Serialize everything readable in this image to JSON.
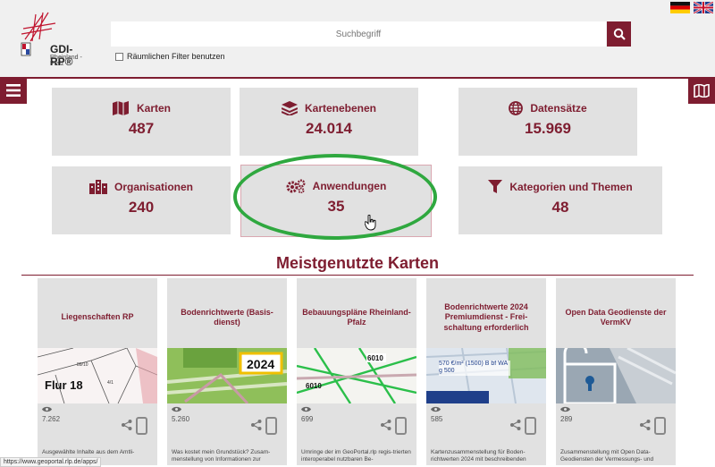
{
  "header": {
    "logo_text": "GDI-RP®",
    "logo_sub": "Rheinland - Pfalz",
    "search_placeholder": "Suchbegriff",
    "filter_label": "Räumlichen Filter benutzen"
  },
  "stats": [
    {
      "label": "Karten",
      "value": "487",
      "icon": "map-icon"
    },
    {
      "label": "Kartenebenen",
      "value": "24.014",
      "icon": "layers-icon"
    },
    {
      "label": "Datensätze",
      "value": "15.969",
      "icon": "globe-icon"
    },
    {
      "label": "Organisationen",
      "value": "240",
      "icon": "building-icon"
    },
    {
      "label": "Anwendungen",
      "value": "35",
      "icon": "gears-icon"
    },
    {
      "label": "Kategorien und Themen",
      "value": "48",
      "icon": "filter-icon"
    }
  ],
  "section_title": "Meistgenutzte Karten",
  "cards": [
    {
      "title": "Liegenschaften RP",
      "views": "7.262",
      "desc": "Ausgewählte Inhalte aus dem Amtli-",
      "img_text": "Flur 18"
    },
    {
      "title": "Bodenrichtwerte (Basis-dienst)",
      "views": "5.260",
      "desc": "Was kostet mein Grundstück? Zusam-menstellung von Informationen zur",
      "img_text": "2024"
    },
    {
      "title": "Bebauungspläne Rheinland-Pfalz",
      "views": "699",
      "desc": "Umringe der im GeoPortal.rlp regis-trierten interoperabel nutzbaren Be-",
      "img_text": "6010"
    },
    {
      "title": "Bodenrichtwerte 2024 Premiumdienst - Frei-schaltung erforderlich",
      "views": "585",
      "desc": "Kartenzusammenstellung für Boden-richtwerten 2024 mit beschreibenden",
      "img_text": "570 €/m² (1500) B bf WA g 500"
    },
    {
      "title": "Open Data Geodienste der VermKV",
      "views": "289",
      "desc": "Zusammenstellung mit Open Data-Geodiensten der Vermessungs- und",
      "img_text": ""
    }
  ],
  "status_url": "https://www.geoportal.rlp.de/apps/",
  "colors": {
    "accent": "#7e1d30",
    "tile_bg": "#e1e1e1",
    "highlight": "#2fa83f"
  }
}
